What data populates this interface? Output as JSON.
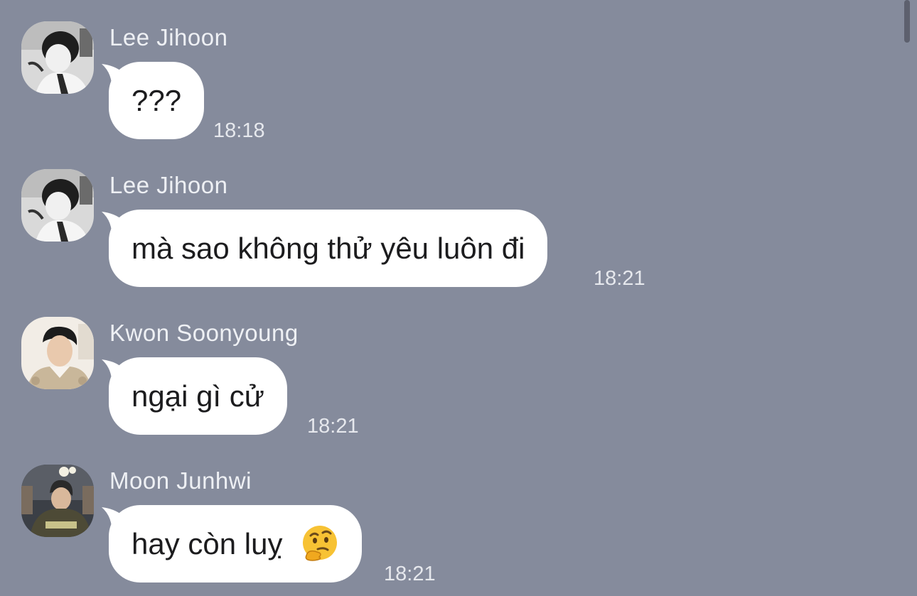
{
  "messages": [
    {
      "sender": "Lee Jihoon",
      "text": "???",
      "time": "18:18",
      "avatar_icon": "avatar-lee-jihoon"
    },
    {
      "sender": "Lee Jihoon",
      "text": "mà sao không thử yêu luôn đi",
      "time": "18:21",
      "avatar_icon": "avatar-lee-jihoon"
    },
    {
      "sender": "Kwon Soonyoung",
      "text": "ngại gì cử",
      "time": "18:21",
      "avatar_icon": "avatar-kwon-soonyoung"
    },
    {
      "sender": "Moon Junhwi",
      "text": "hay còn luỵ",
      "time": "18:21",
      "avatar_icon": "avatar-moon-junhwi",
      "emoji": "thinking-face"
    }
  ],
  "colors": {
    "background": "#858b9c",
    "bubble": "#ffffff",
    "sender_text": "#eef0f4",
    "time_text": "#e6e8ed"
  }
}
